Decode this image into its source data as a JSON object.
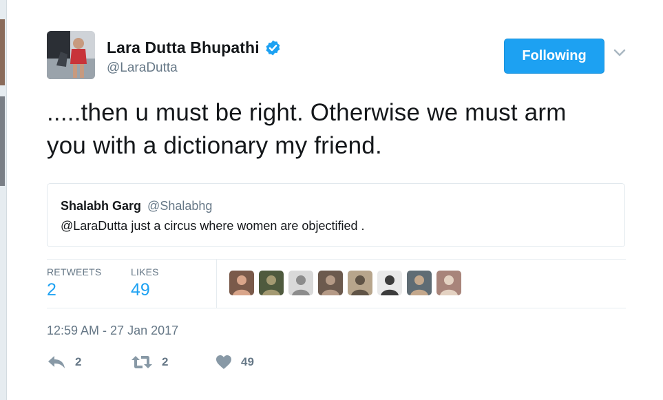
{
  "author": {
    "display_name": "Lara Dutta Bhupathi",
    "handle": "@LaraDutta",
    "verified": true,
    "avatar_icon": "avatar-photo"
  },
  "follow_button": {
    "label": "Following"
  },
  "menu_icon": "chevron-down-icon",
  "tweet": {
    "text": ".....then u must be right. Otherwise we must arm you with a dictionary my friend."
  },
  "quoted_tweet": {
    "name": "Shalabh Garg",
    "handle": "@Shalabhg",
    "text": "@LaraDutta just a circus where women are objectified ."
  },
  "stats": {
    "retweets_label": "RETWEETS",
    "retweets_count": "2",
    "likes_label": "LIKES",
    "likes_count": "49"
  },
  "likers": [
    {
      "name": "liker-1",
      "bg": "#7a5a4a",
      "fg": "#d9a58a"
    },
    {
      "name": "liker-2",
      "bg": "#4f5a3e",
      "fg": "#a49a72"
    },
    {
      "name": "liker-3",
      "bg": "#d9d9d9",
      "fg": "#8c8c8c"
    },
    {
      "name": "liker-4",
      "bg": "#6c5a4e",
      "fg": "#b59a86"
    },
    {
      "name": "liker-5",
      "bg": "#b7a58c",
      "fg": "#5f5346"
    },
    {
      "name": "liker-6",
      "bg": "#e9e9e9",
      "fg": "#3c3c3c"
    },
    {
      "name": "liker-7",
      "bg": "#5f6c74",
      "fg": "#c4a88c"
    },
    {
      "name": "liker-8",
      "bg": "#a8847a",
      "fg": "#e4d2c2"
    }
  ],
  "timestamp": "12:59 AM - 27 Jan 2017",
  "actions": {
    "reply_count": "2",
    "retweet_count": "2",
    "like_count": "49"
  },
  "colors": {
    "accent": "#1da1f2",
    "muted": "#657786",
    "text": "#14171a",
    "border": "#e1e8ed"
  }
}
